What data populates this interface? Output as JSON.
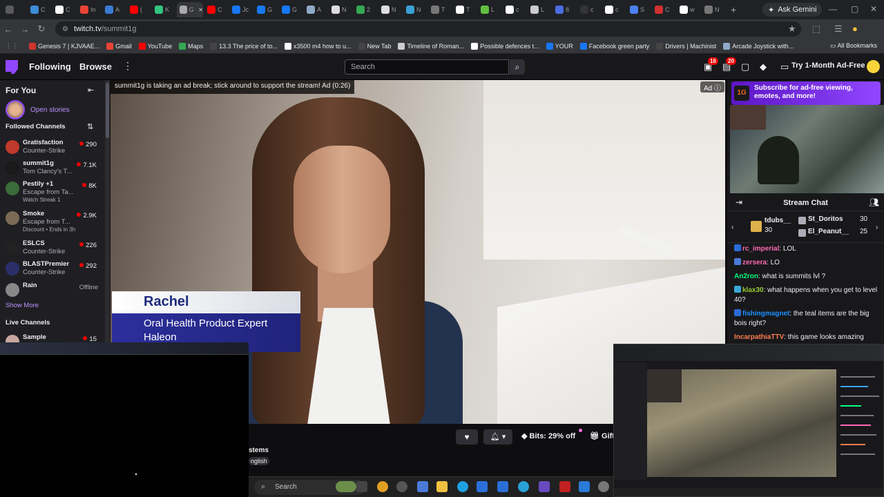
{
  "browser": {
    "tabs": [
      {
        "icon": "generic-tab-icon",
        "color": "#5a5a5a",
        "text": ""
      },
      {
        "icon": "windows-tab-icon",
        "color": "#3c8cd8",
        "text": "C"
      },
      {
        "icon": "file-tab-icon",
        "color": "#ffffff",
        "text": "C"
      },
      {
        "icon": "gmail-tab-icon",
        "color": "#ea4335",
        "text": "In"
      },
      {
        "icon": "app-tab-icon",
        "color": "#3a7bd5",
        "text": "A"
      },
      {
        "icon": "youtube-tab-icon",
        "color": "#ff0000",
        "text": "("
      },
      {
        "icon": "app-tab-icon",
        "color": "#33c481",
        "text": "K"
      },
      {
        "icon": "chrome-tab-icon",
        "color": "#aaaaaa",
        "text": "G"
      },
      {
        "icon": "youtube-tab-icon",
        "color": "#ff0000",
        "text": "C"
      },
      {
        "icon": "facebook-tab-icon",
        "color": "#1877f2",
        "text": "Jc"
      },
      {
        "icon": "facebook-tab-icon",
        "color": "#1877f2",
        "text": "G"
      },
      {
        "icon": "facebook-tab-icon",
        "color": "#1877f2",
        "text": "G"
      },
      {
        "icon": "grid-tab-icon",
        "color": "#8fa9c8",
        "text": "A"
      },
      {
        "icon": "nz-tab-icon",
        "color": "#dddddd",
        "text": "N"
      },
      {
        "icon": "maps-tab-icon",
        "color": "#34a853",
        "text": "2"
      },
      {
        "icon": "nasdaq-tab-icon",
        "color": "#dddddd",
        "text": "N"
      },
      {
        "icon": "app-tab-icon",
        "color": "#3aa0d8",
        "text": "N"
      },
      {
        "icon": "circle-tab-icon",
        "color": "#777777",
        "text": "T"
      },
      {
        "icon": "google-tab-icon",
        "color": "#ffffff",
        "text": "T"
      },
      {
        "icon": "app-tab-icon",
        "color": "#60c040",
        "text": "L"
      },
      {
        "icon": "google-tab-icon",
        "color": "#ffffff",
        "text": "c"
      },
      {
        "icon": "pen-tab-icon",
        "color": "#cccccc",
        "text": "L"
      },
      {
        "icon": "shield-tab-icon",
        "color": "#4a6ee0",
        "text": "8"
      },
      {
        "icon": "app-tab-icon",
        "color": "#333333",
        "text": "c"
      },
      {
        "icon": "google-tab-icon",
        "color": "#ffffff",
        "text": "c"
      },
      {
        "icon": "gear-tab-icon",
        "color": "#4a80f0",
        "text": "S"
      },
      {
        "icon": "app-tab-icon",
        "color": "#d03030",
        "text": "C"
      },
      {
        "icon": "google-tab-icon",
        "color": "#ffffff",
        "text": "w"
      },
      {
        "icon": "circle-tab-icon",
        "color": "#777777",
        "text": "N"
      }
    ],
    "new_tab": "+",
    "ask_gemini": "Ask Gemini",
    "url_host": "twitch.tv",
    "url_path": "/summit1g",
    "bookmarks": [
      {
        "label": "Genesis 7 | KJVAAE...",
        "color": "#d0342c"
      },
      {
        "label": "Gmail",
        "color": "#ea4335"
      },
      {
        "label": "YouTube",
        "color": "#ff0000"
      },
      {
        "label": "Maps",
        "color": "#34a853"
      },
      {
        "label": "13.3 The price of to...",
        "color": "#444444"
      },
      {
        "label": "x3500 m4 how to u...",
        "color": "#ffffff"
      },
      {
        "label": "New Tab",
        "color": "#444444"
      },
      {
        "label": "Timeline of Roman...",
        "color": "#cccccc"
      },
      {
        "label": "Possible defences t...",
        "color": "#ffffff"
      },
      {
        "label": "YOUR",
        "color": "#1877f2"
      },
      {
        "label": "Facebook green party",
        "color": "#1877f2"
      },
      {
        "label": "Drivers | Machinist",
        "color": "#444444"
      },
      {
        "label": "Arcade Joystick with...",
        "color": "#8fa9c8"
      }
    ],
    "all_bookmarks": "All Bookmarks"
  },
  "twitch": {
    "nav": {
      "following": "Following",
      "browse": "Browse",
      "search_placeholder": "Search",
      "inbox_badge": "16",
      "notif_badge": "20",
      "ad_free_cta": "Try 1-Month Ad-Free"
    },
    "sidebar": {
      "header": "For You",
      "open_stories": "Open stories",
      "followed_header": "Followed Channels",
      "channels": [
        {
          "name": "Gratisfaction",
          "game": "Counter-Strike",
          "viewers": "290",
          "extra": "",
          "color": "#c0392b"
        },
        {
          "name": "summit1g",
          "game": "Tom Clancy's T...",
          "viewers": "7.1K",
          "extra": "",
          "color": "#1a1a1a"
        },
        {
          "name": "Pestily +1",
          "game": "Escape from Ta...",
          "viewers": "8K",
          "extra": "Watch Streak 1",
          "color": "#3a6b3a"
        },
        {
          "name": "Smoke",
          "game": "Escape from T...",
          "viewers": "2.9K",
          "extra": "Discount • Ends in 3h",
          "color": "#7a6a55"
        },
        {
          "name": "ESLCS",
          "game": "Counter-Strike",
          "viewers": "226",
          "extra": "",
          "color": "#222222"
        },
        {
          "name": "BLASTPremier",
          "game": "Counter-Strike",
          "viewers": "292",
          "extra": "",
          "color": "#2a2f6a"
        },
        {
          "name": "Rain",
          "game": "",
          "viewers": "",
          "offline": "Offline",
          "extra": "",
          "color": "#888888"
        }
      ],
      "show_more": "Show More",
      "live_header": "Live Channels",
      "live_channels": [
        {
          "name": "Sample",
          "viewers": "15"
        }
      ]
    },
    "player": {
      "ad_break_notice": "summit1g is taking an ad break; stick around to support the stream! Ad (0:26)",
      "ad_tag": "Ad",
      "lower_third_name": "Rachel",
      "lower_third_title": "Oral Health Product Expert",
      "lower_third_company": "Haleon"
    },
    "below_video": {
      "bits": "Bits: 29% off",
      "gift": "Gift",
      "category_partial": "stems",
      "language_partial": "nglish"
    },
    "right": {
      "promo": "Subscribe for ad-free viewing, emotes, and more!",
      "promo_logo": "1G",
      "chat_title": "Stream Chat",
      "gifters": [
        {
          "name": "tdubs__",
          "count": "30"
        },
        {
          "name": "St_Doritos",
          "count": "30"
        },
        {
          "name": "El_Peanut__",
          "count": "25"
        }
      ],
      "messages": [
        {
          "user": "rc_imperial",
          "text": ": LOL",
          "color": "#ff69b4",
          "badge": "#2b6bd6"
        },
        {
          "user": "zersera",
          "text": ": LO",
          "color": "#ff69b4",
          "badge": "#4b7bd8"
        },
        {
          "user": "An2ron",
          "text": ": what is summits lvl ?",
          "color": "#00ff7f",
          "badge": ""
        },
        {
          "user": "klax30",
          "text": ": what happens when you get to level 40?",
          "color": "#9acd32",
          "badge": "#3ba7d8"
        },
        {
          "user": "fishingmagnet",
          "text": ": the teal items are the big bois right?",
          "color": "#1e90ff",
          "badge": "#2b6bd6"
        },
        {
          "user": "IncarpathiaTTV",
          "text": ": this game looks amazing",
          "color": "#ff7f50",
          "badge": ""
        }
      ]
    }
  },
  "taskbar": {
    "search": "Search"
  }
}
